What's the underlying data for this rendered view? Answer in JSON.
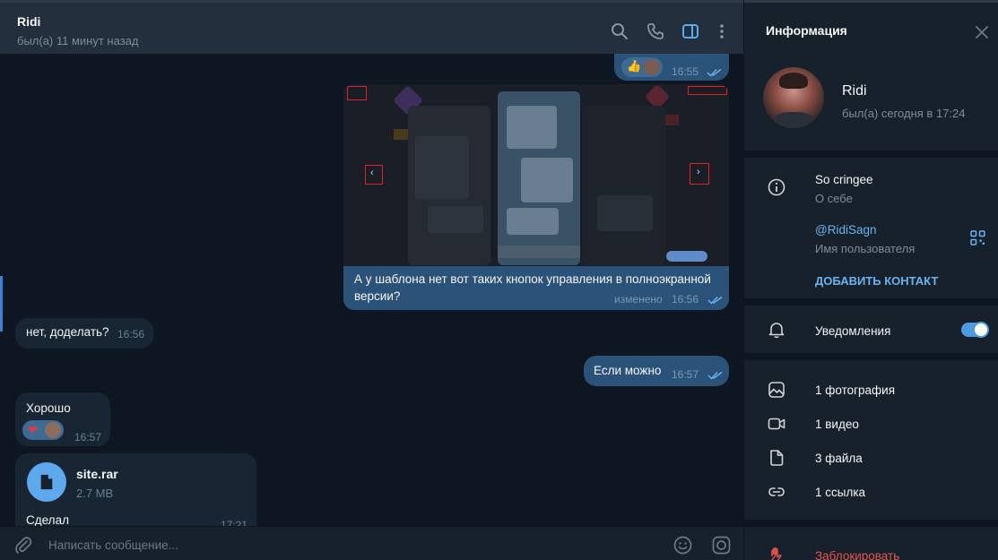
{
  "header": {
    "chat_name": "Ridi",
    "chat_status": "был(а) 11 минут назад",
    "icons": [
      "search-icon",
      "phone-icon",
      "sidebar-toggle-icon",
      "more-vertical-icon"
    ]
  },
  "messages": [
    {
      "side": "out",
      "kind": "reaction",
      "reaction": "👍",
      "time": "16:55",
      "read": true
    },
    {
      "side": "out",
      "kind": "media",
      "caption": "А у шаблона нет вот таких кнопок управления в полноэкранной версии?",
      "edited_label": "изменено",
      "time": "16:56",
      "read": true
    },
    {
      "side": "in",
      "text": "нет, доделать?",
      "time": "16:56"
    },
    {
      "side": "out",
      "text": "Если можно",
      "time": "16:57",
      "read": true
    },
    {
      "side": "in",
      "text": "Хорошо",
      "reaction": "❤",
      "time": "16:57"
    },
    {
      "side": "in",
      "kind": "file",
      "file_name": "site.rar",
      "file_size": "2.7 MB",
      "text": "Сделал",
      "time": "17:21"
    }
  ],
  "composer": {
    "placeholder": "Написать сообщение...",
    "icons": [
      "attach-icon",
      "emoji-icon",
      "camera-icon"
    ]
  },
  "info_panel": {
    "title": "Информация",
    "name": "Ridi",
    "status": "был(а) сегодня в 17:24",
    "bio": "So cringee",
    "bio_label": "О себе",
    "username": "@RidiSagn",
    "username_label": "Имя пользователя",
    "add_contact": "ДОБАВИТЬ КОНТАКТ",
    "notifications_label": "Уведомления",
    "notifications_on": true,
    "media": [
      {
        "icon": "photo-icon",
        "label": "1 фотография"
      },
      {
        "icon": "video-icon",
        "label": "1 видео"
      },
      {
        "icon": "file-icon",
        "label": "3 файла"
      },
      {
        "icon": "link-icon",
        "label": "1 ссылка"
      }
    ],
    "block_label": "Заблокировать"
  },
  "colors": {
    "accent": "#6ab3f3",
    "outgoing_bubble": "#2b5278",
    "incoming_bubble": "#182533",
    "chat_background": "#0e1621",
    "panel_background": "#17212b",
    "danger": "#e5554f"
  }
}
